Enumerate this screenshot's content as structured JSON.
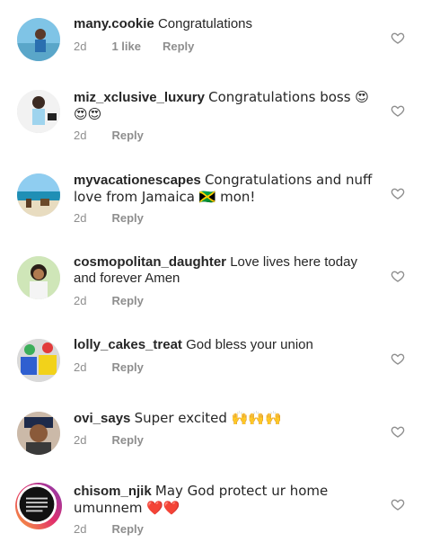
{
  "comments": [
    {
      "username": "many.cookie",
      "text": "Congratulations",
      "time": "2d",
      "likes": "1 like",
      "reply": "Reply"
    },
    {
      "username": "miz_xclusive_luxury",
      "text": "Congratulations boss 😍😍😍",
      "time": "2d",
      "reply": "Reply"
    },
    {
      "username": "myvacationescapes",
      "text": "Congratulations and nuff love from Jamaica 🇯🇲 mon!",
      "time": "2d",
      "reply": "Reply"
    },
    {
      "username": "cosmopolitan_daughter",
      "text": "Love lives here today and forever Amen",
      "time": "2d",
      "reply": "Reply"
    },
    {
      "username": "lolly_cakes_treat",
      "text": "God bless your union",
      "time": "2d",
      "reply": "Reply"
    },
    {
      "username": "ovi_says",
      "text": "Super excited 🙌🙌🙌",
      "time": "2d",
      "reply": "Reply"
    },
    {
      "username": "chisom_njik",
      "text": "May God protect ur home umunnem ❤️❤️",
      "time": "2d",
      "reply": "Reply"
    }
  ],
  "icons": {
    "like": "heart-outline-icon"
  },
  "colors": {
    "meta": "#8e8e8e",
    "text": "#262626",
    "heart_stroke": "#8e8e8e"
  }
}
